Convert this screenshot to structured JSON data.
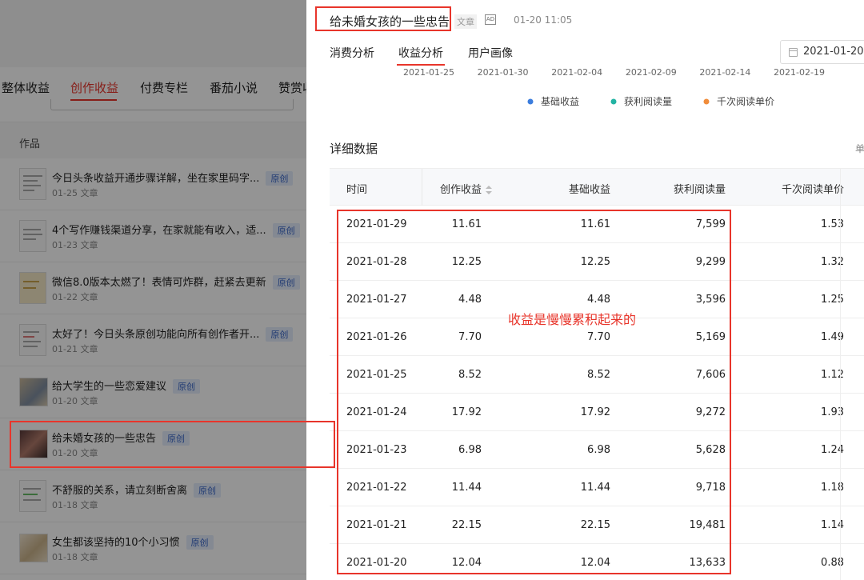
{
  "left": {
    "tabs": [
      "整体收益",
      "创作收益",
      "付费专栏",
      "番茄小说",
      "赞赏收"
    ],
    "active_tab": "创作收益",
    "works_header": "作品",
    "articles": [
      {
        "title": "今日头条收益开通步骤详解，坐在家里码字...",
        "badge": "原创",
        "date": "01-25",
        "type": "文章"
      },
      {
        "title": "4个写作赚钱渠道分享，在家就能有收入，适...",
        "badge": "原创",
        "date": "01-23",
        "type": "文章"
      },
      {
        "title": "微信8.0版本太燃了！表情可炸群，赶紧去更新",
        "badge": "原创",
        "date": "01-22",
        "type": "文章"
      },
      {
        "title": "太好了！今日头条原创功能向所有创作者开...",
        "badge": "原创",
        "date": "01-21",
        "type": "文章"
      },
      {
        "title": "给大学生的一些恋爱建议",
        "badge": "原创",
        "date": "01-20",
        "type": "文章"
      },
      {
        "title": "给未婚女孩的一些忠告",
        "badge": "原创",
        "date": "01-20",
        "type": "文章"
      },
      {
        "title": "不舒服的关系，请立刻断舍离",
        "badge": "原创",
        "date": "01-18",
        "type": "文章"
      },
      {
        "title": "女生都该坚持的10个小习惯",
        "badge": "原创",
        "date": "01-18",
        "type": "文章"
      }
    ]
  },
  "panel": {
    "article_title": "给未婚女孩的一些忠告",
    "article_type": "文章",
    "ad_label": "AD",
    "publish_time": "01-20 11:05",
    "tabs": [
      "消费分析",
      "收益分析",
      "用户画像"
    ],
    "active_tab": "收益分析",
    "date_value": "2021-01-20",
    "detail_title": "详细数据",
    "unit_cut": "单",
    "annotation": "收益是慢慢累积起来的",
    "table": {
      "headers": [
        "时间",
        "创作收益",
        "基础收益",
        "获利阅读量",
        "千次阅读单价"
      ],
      "rows": [
        [
          "2021-01-29",
          "11.61",
          "11.61",
          "7,599",
          "1.53"
        ],
        [
          "2021-01-28",
          "12.25",
          "12.25",
          "9,299",
          "1.32"
        ],
        [
          "2021-01-27",
          "4.48",
          "4.48",
          "3,596",
          "1.25"
        ],
        [
          "2021-01-26",
          "7.70",
          "7.70",
          "5,169",
          "1.49"
        ],
        [
          "2021-01-25",
          "8.52",
          "8.52",
          "7,606",
          "1.12"
        ],
        [
          "2021-01-24",
          "17.92",
          "17.92",
          "9,272",
          "1.93"
        ],
        [
          "2021-01-23",
          "6.98",
          "6.98",
          "5,628",
          "1.24"
        ],
        [
          "2021-01-22",
          "11.44",
          "11.44",
          "9,718",
          "1.18"
        ],
        [
          "2021-01-21",
          "22.15",
          "22.15",
          "19,481",
          "1.14"
        ],
        [
          "2021-01-20",
          "12.04",
          "12.04",
          "13,633",
          "0.88"
        ]
      ]
    }
  },
  "chart_data": {
    "type": "line",
    "x_ticks": [
      "2021-01-25",
      "2021-01-30",
      "2021-02-04",
      "2021-02-09",
      "2021-02-14",
      "2021-02-19"
    ],
    "legend": [
      {
        "name": "基础收益",
        "color": "#3b7ddd"
      },
      {
        "name": "获利阅读量",
        "color": "#22b3a3"
      },
      {
        "name": "千次阅读单价",
        "color": "#f08c3a"
      }
    ],
    "legend_position": "top-center"
  },
  "colors": {
    "accent": "#e8352b",
    "badge_bg": "#e3ecfb",
    "badge_text": "#3a66c8"
  }
}
